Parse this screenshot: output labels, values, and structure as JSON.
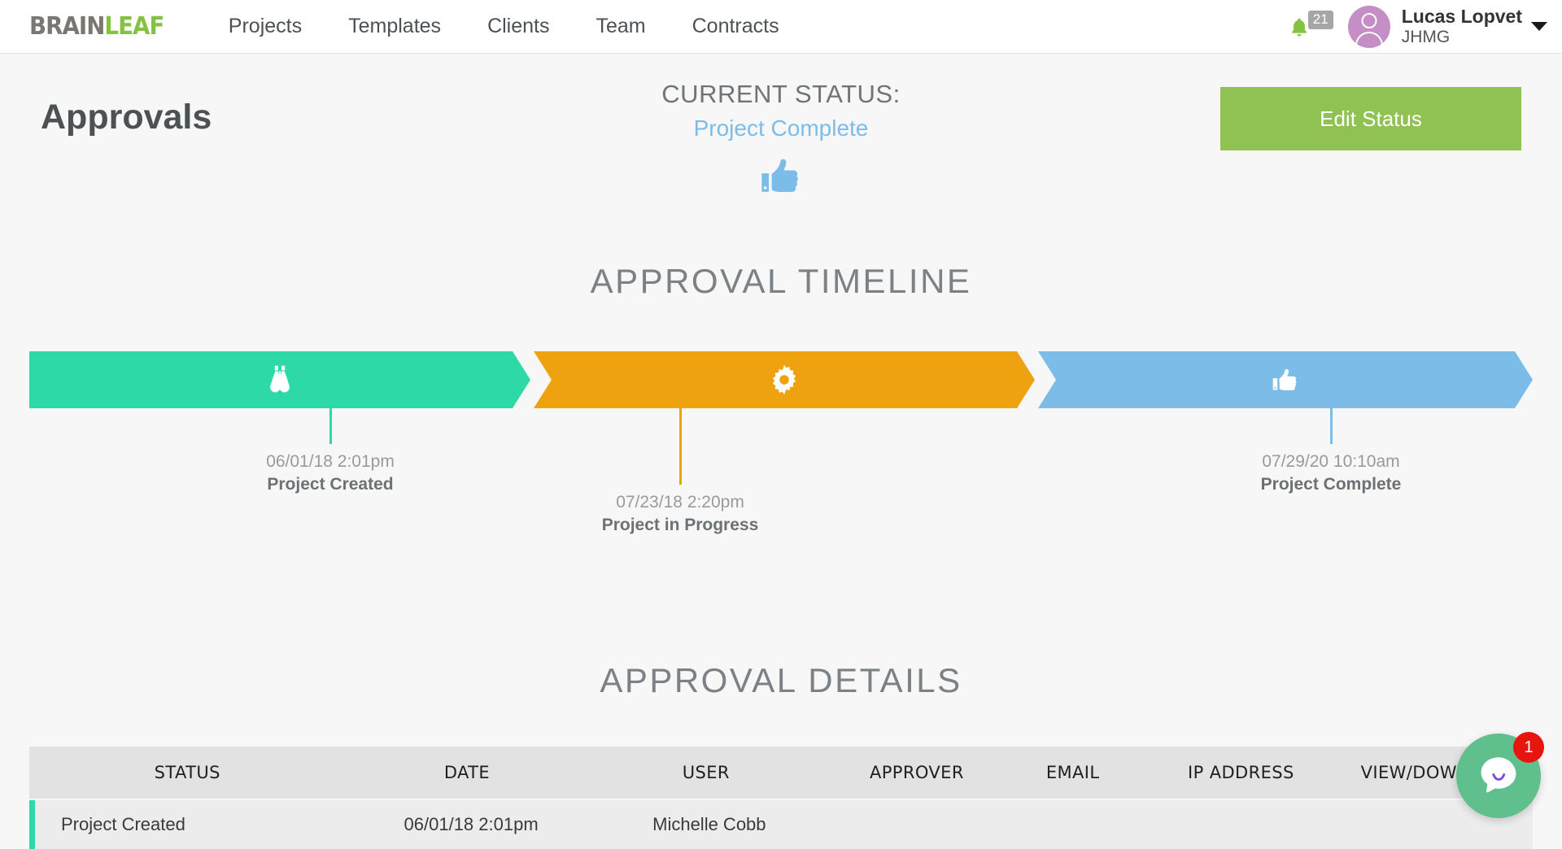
{
  "brand": {
    "logo_part1": "BRAIN",
    "logo_part2": "LEAF",
    "color_brain": "#7b7671",
    "color_leaf": "#83c341"
  },
  "nav": {
    "items": [
      {
        "label": "Projects"
      },
      {
        "label": "Templates"
      },
      {
        "label": "Clients"
      },
      {
        "label": "Team"
      },
      {
        "label": "Contracts"
      }
    ],
    "notifications": {
      "icon": "bell-icon",
      "count": "21",
      "badge_color": "#a6a6a6",
      "bell_color": "#83c341"
    },
    "user": {
      "name": "Lucas Lopvet",
      "company": "JHMG",
      "avatar_icon": "user-avatar-icon",
      "avatar_color": "#c58ec4",
      "caret_icon": "chevron-down-icon"
    }
  },
  "page": {
    "title": "Approvals",
    "status": {
      "label": "CURRENT STATUS:",
      "value": "Project Complete",
      "value_color": "#7cbce8",
      "icon": "thumbs-up-icon"
    },
    "edit_status_button": {
      "label": "Edit Status",
      "color": "#8fc253"
    }
  },
  "timeline": {
    "heading": "APPROVAL TIMELINE",
    "steps": [
      {
        "icon": "binoculars-icon",
        "color": "#2ed9a8",
        "date": "06/01/18 2:01pm",
        "label": "Project Created"
      },
      {
        "icon": "gear-icon",
        "color": "#eea210",
        "date": "07/23/18 2:20pm",
        "label": "Project in Progress"
      },
      {
        "icon": "thumbs-up-icon",
        "color": "#7cbce8",
        "date": "07/29/20 10:10am",
        "label": "Project Complete"
      }
    ]
  },
  "details": {
    "heading": "APPROVAL DETAILS",
    "columns": [
      "STATUS",
      "DATE",
      "USER",
      "APPROVER",
      "EMAIL",
      "IP ADDRESS",
      "VIEW/DOWNLOAD"
    ],
    "rows": [
      {
        "status": "Project Created",
        "date": "06/01/18 2:01pm",
        "user": "Michelle Cobb",
        "approver": "",
        "email": "",
        "ip_address": "",
        "view_download": "",
        "accent_color": "#2ed9a8"
      }
    ]
  },
  "chat": {
    "icon": "chat-bubble-icon",
    "badge_count": "1",
    "bubble_color": "#5fc08e",
    "badge_color": "#e8150f"
  }
}
